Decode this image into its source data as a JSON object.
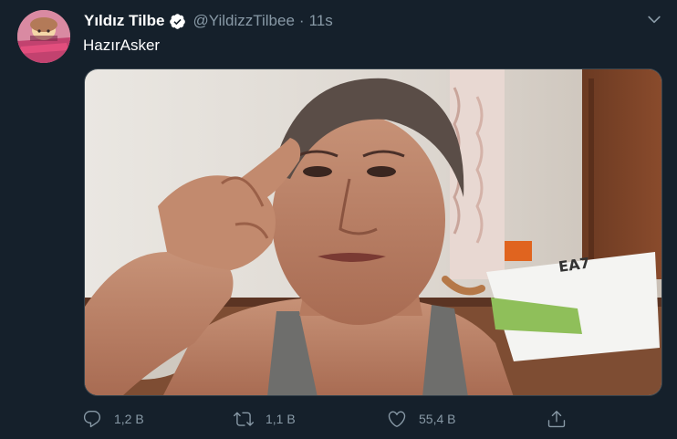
{
  "tweet": {
    "author_name": "Yıldız Tilbe",
    "author_handle": "@YildizzTilbee",
    "separator": "·",
    "time": "11s",
    "text": "HazırAsker",
    "reply_count": "1,2 B",
    "retweet_count": "1,1 B",
    "like_count": "55,4 B",
    "verified": true
  },
  "icons": {
    "verified": "verified-badge-icon",
    "more": "chevron-down-icon",
    "reply": "reply-icon",
    "retweet": "retweet-icon",
    "like": "heart-icon",
    "share": "share-icon"
  },
  "colors": {
    "background": "#15202b",
    "secondary_text": "#8899a6",
    "primary_text": "#ffffff",
    "accent": "#1da1f2",
    "border": "#38444d"
  }
}
